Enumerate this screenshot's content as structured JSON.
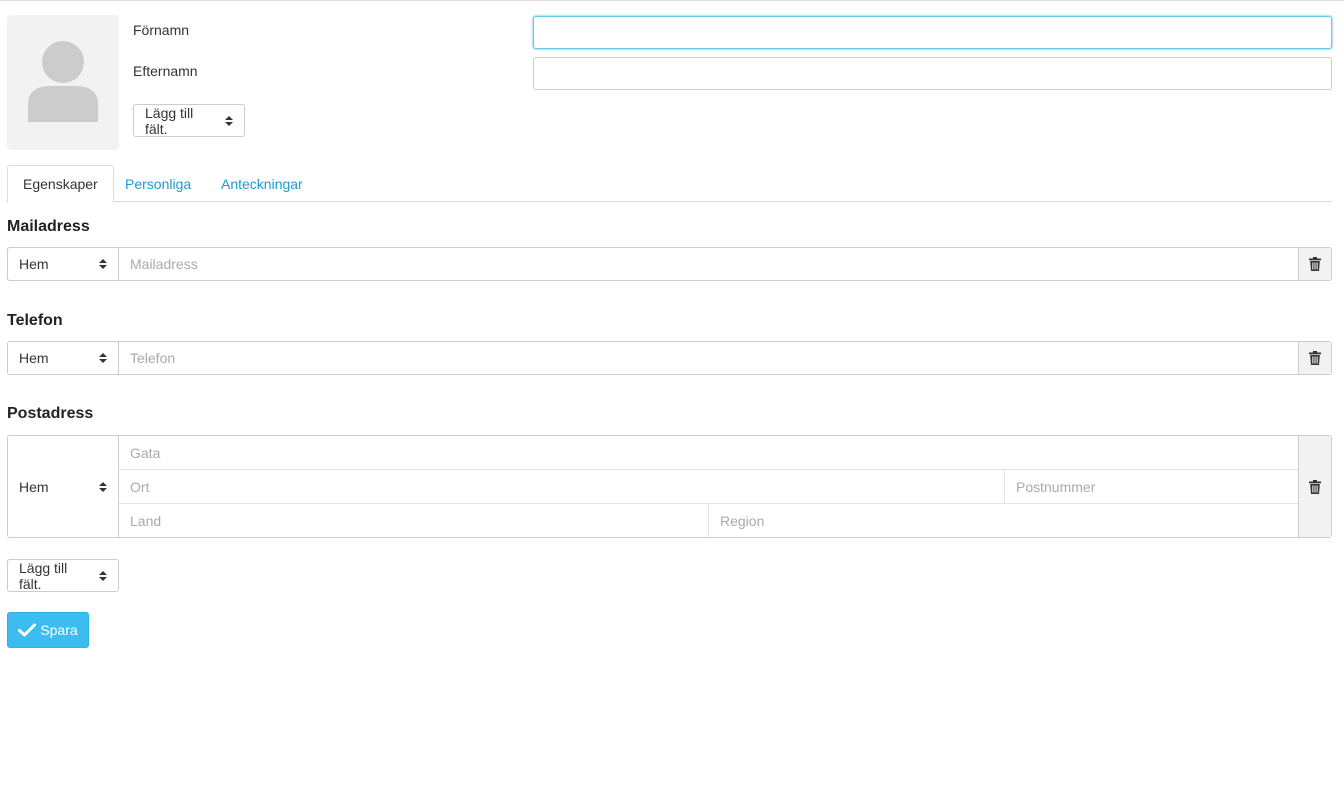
{
  "header": {
    "first_name_label": "Förnamn",
    "first_name_value": "",
    "last_name_label": "Efternamn",
    "last_name_value": "",
    "add_field_label": "Lägg till fält."
  },
  "tabs": [
    {
      "label": "Egenskaper",
      "active": true
    },
    {
      "label": "Personliga",
      "active": false
    },
    {
      "label": "Anteckningar",
      "active": false
    }
  ],
  "email": {
    "title": "Mailadress",
    "type": "Hem",
    "placeholder": "Mailadress"
  },
  "phone": {
    "title": "Telefon",
    "type": "Hem",
    "placeholder": "Telefon"
  },
  "address": {
    "title": "Postadress",
    "type": "Hem",
    "street_placeholder": "Gata",
    "city_placeholder": "Ort",
    "zip_placeholder": "Postnummer",
    "country_placeholder": "Land",
    "region_placeholder": "Region"
  },
  "footer": {
    "add_field_label": "Lägg till fält.",
    "save_label": "Spara"
  },
  "colors": {
    "accent": "#3bbdf0",
    "link": "#1c9ad6",
    "focus_border": "#66c8ea"
  },
  "icons": {
    "avatar": "person-silhouette-icon",
    "trash": "trash-icon",
    "save": "check-icon",
    "select": "sort-arrows-icon"
  }
}
